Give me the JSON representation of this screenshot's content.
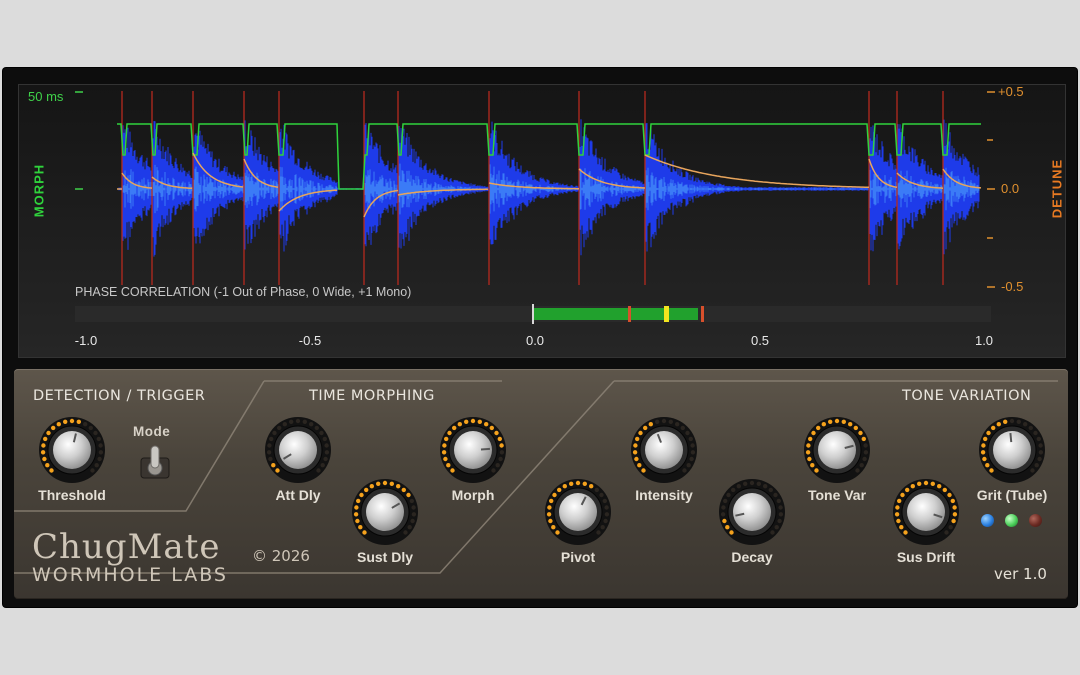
{
  "display": {
    "time_label": "50 ms",
    "morph_label": "MORPH",
    "detune_label": "DETUNE",
    "detune_scale": [
      "+0.5",
      "0.0",
      "-0.5"
    ],
    "phase_title": "PHASE CORRELATION (-1 Out of Phase, 0 Wide, +1 Mono)",
    "phase_ticks": [
      "-1.0",
      "-0.5",
      "0.0",
      "0.5",
      "1.0"
    ],
    "phase_meter": {
      "range_start": 0.0,
      "range_end": 0.36,
      "marker_low": 0.21,
      "marker_mid": 0.29,
      "marker_high": 0.37
    }
  },
  "sections": {
    "detection": "DETECTION / TRIGGER",
    "time_morphing": "TIME MORPHING",
    "tone_variation": "TONE VARIATION"
  },
  "controls": {
    "threshold": "Threshold",
    "mode": "Mode",
    "att_dly": "Att Dly",
    "sust_dly": "Sust Dly",
    "morph": "Morph",
    "pivot": "Pivot",
    "intensity": "Intensity",
    "decay": "Decay",
    "tone_var": "Tone Var",
    "sus_drift": "Sus Drift",
    "grit": "Grit (Tube)"
  },
  "branding": {
    "name": "ChugMate",
    "company": "WORMHOLE LABS",
    "copyright": "© 2026",
    "version": "ver 1.0"
  },
  "colors": {
    "waveform": "#1f3df5",
    "morph": "#2fd33c",
    "detune": "#e87a22",
    "trigger": "#b52a1e",
    "led_blue": "#2a7fe0",
    "led_green": "#4bcf5a",
    "led_red": "#6b2a22"
  }
}
